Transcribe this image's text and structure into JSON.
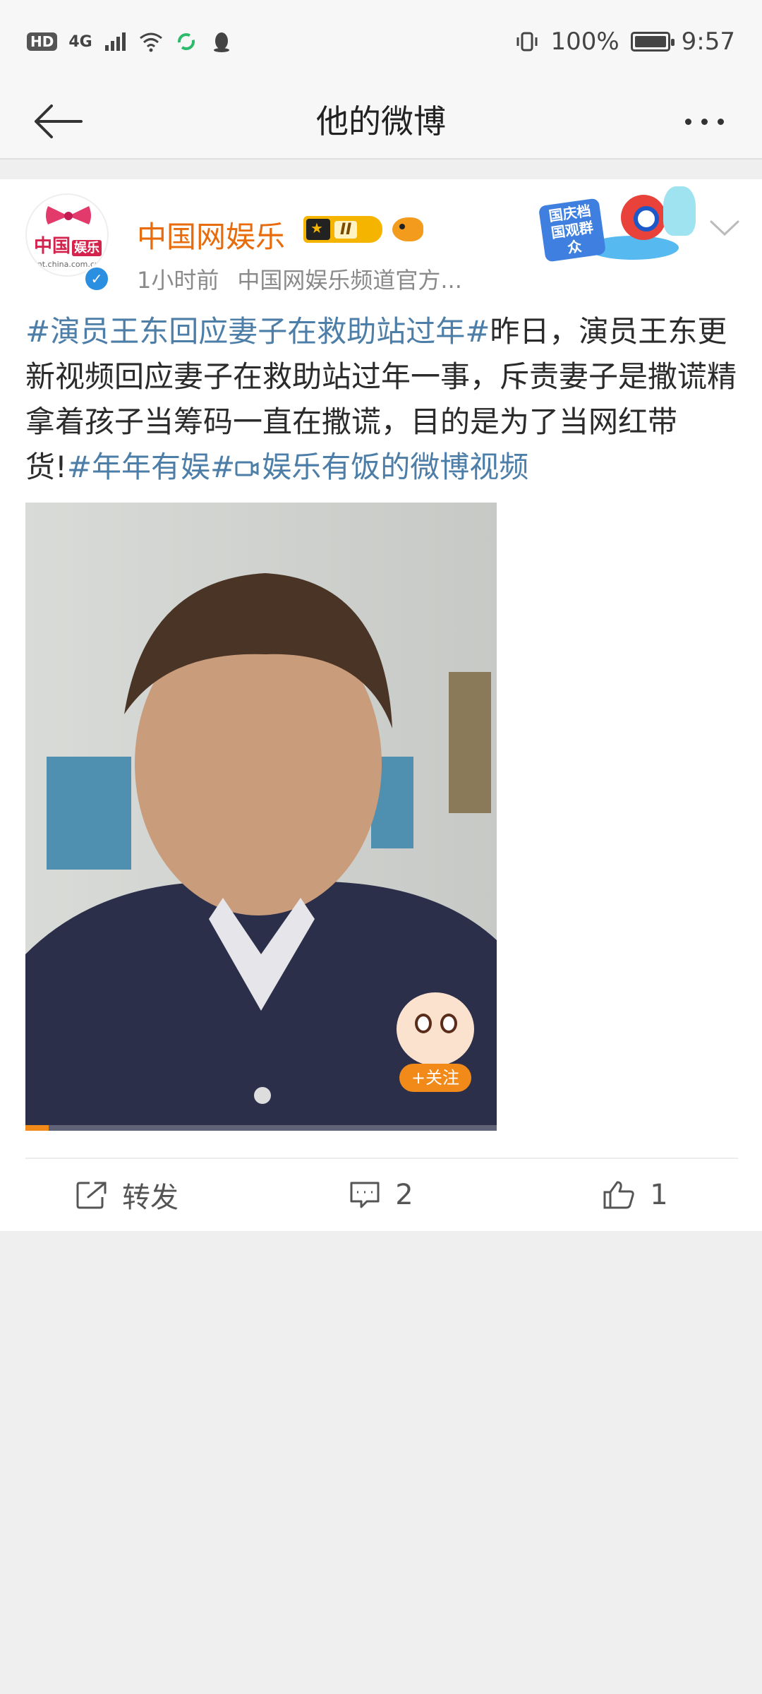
{
  "status_bar": {
    "hd": "HD",
    "network": "4G",
    "battery": "100%",
    "time": "9:57"
  },
  "nav": {
    "title": "他的微博"
  },
  "post": {
    "user": {
      "name": "中国网娱乐",
      "rank_level": "II",
      "avatar_text": "中国",
      "avatar_tag": "娱乐",
      "avatar_url": "ent.china.com.cn"
    },
    "promo": {
      "text": "国庆档 国观群众"
    },
    "time_ago": "1小时前",
    "source": "中国网娱乐频道官方...",
    "text_segments": [
      {
        "text": "#演员王东回应妻子在救助站过年#",
        "type": "tag"
      },
      {
        "text": "昨日，演员王东更新视频回应妻子在救助站过年一事，斥责妻子是撒谎精拿着孩子当筹码一直在撒谎，目的是为了当网红带货!",
        "type": "plain"
      },
      {
        "text": "#年年有娱#",
        "type": "tag"
      },
      {
        "text": "娱乐有饭的微博视频",
        "type": "tag"
      }
    ],
    "video": {
      "follow_label": "+关注",
      "progress": 0.05
    },
    "actions": {
      "repost_label": "转发",
      "comment_count": "2",
      "like_count": "1"
    }
  },
  "colors": {
    "username": "#e86b0c",
    "hashtag": "#4d7ea8",
    "verify": "#2a8fe0",
    "background": "#efefef"
  },
  "icons": {
    "back": "arrow-left-icon",
    "more": "more-dots-icon",
    "repost": "share-icon",
    "comment": "comment-icon",
    "like": "thumbs-up-icon"
  }
}
